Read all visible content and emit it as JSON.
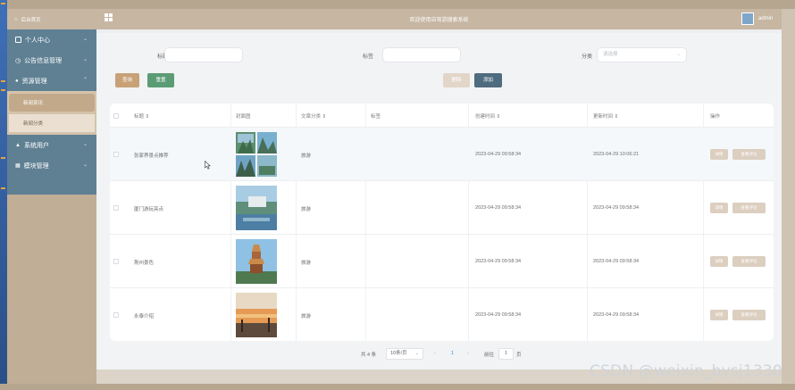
{
  "topbar": {
    "title": "欢迎使用自驾游搜索系统",
    "user": "admin"
  },
  "sidebar": {
    "brand": "后台首页",
    "items": [
      {
        "label": "个人中心",
        "icon": "user-center-icon",
        "has_chevron": true
      },
      {
        "label": "公告信息管理",
        "icon": "clock-icon",
        "has_chevron": true
      },
      {
        "label": "资源管理",
        "icon": "location-icon",
        "has_chevron": true,
        "expanded": true
      }
    ],
    "sub_items": [
      {
        "label": "新闻资讯",
        "active": true
      },
      {
        "label": "新闻分类",
        "active": false
      }
    ],
    "lower_items": [
      {
        "label": "系统用户",
        "icon": "person-icon"
      },
      {
        "label": "模块管理",
        "icon": "grid-icon"
      }
    ]
  },
  "filters": {
    "title_label": "标题",
    "tag_label": "标签",
    "category_label": "分类",
    "category_placeholder": "请选择"
  },
  "buttons": {
    "search": "查询",
    "reset": "重置",
    "delete": "删除",
    "add": "添加"
  },
  "table": {
    "headers": [
      "标题 ⇕",
      "封面图",
      "文章分类 ⇕",
      "标签",
      "创建时间 ⇕",
      "更新时间 ⇕",
      "操作"
    ],
    "rows": [
      {
        "title": "张家界景点推荐",
        "category": "旅游",
        "tag": "",
        "created": "2023-04-29 09:58:34",
        "updated": "2023-04-29 10:06:21"
      },
      {
        "title": "厦门游玩亮点",
        "category": "旅游",
        "tag": "",
        "created": "2023-04-29 09:58:34",
        "updated": "2023-04-29 09:58:34"
      },
      {
        "title": "荆州景色",
        "category": "旅游",
        "tag": "",
        "created": "2023-04-29 09:58:34",
        "updated": "2023-04-29 09:58:34"
      },
      {
        "title": "永泰介绍",
        "category": "旅游",
        "tag": "",
        "created": "2023-04-29 09:58:34",
        "updated": "2023-04-29 09:58:34"
      }
    ],
    "action_detail": "详情",
    "action_comment": "查看评论"
  },
  "pagination": {
    "total": "共 4 条",
    "page_size": "10条/页",
    "prev": "‹",
    "current": "1",
    "next": "›",
    "goto_prefix": "前往",
    "goto_value": "1",
    "goto_suffix": "页"
  },
  "watermark": "CSDN @weixin_bysj1330",
  "colors": {
    "sidebar": "#5f8093",
    "accent_tan": "#c6b6a2",
    "search_btn": "#c8a177",
    "reset_btn": "#5c9c74",
    "add_btn": "#4f6b7f",
    "delete_btn": "#e2d6c9"
  }
}
